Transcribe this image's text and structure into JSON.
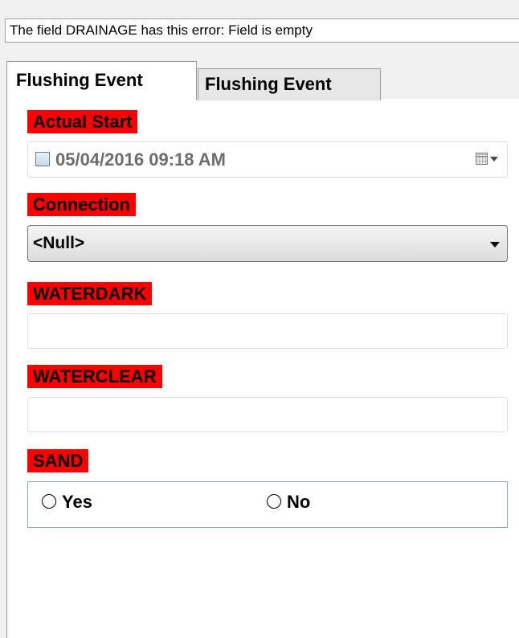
{
  "error_message": "The field DRAINAGE has this error: Field is empty",
  "tabs": [
    {
      "label": "Flushing Event",
      "active": true
    },
    {
      "label": "Flushing Event",
      "active": false
    }
  ],
  "form": {
    "actual_start": {
      "label": "Actual Start",
      "value": "05/04/2016 09:18 AM",
      "checked": false
    },
    "connection": {
      "label": "Connection",
      "selected": "<Null>"
    },
    "waterdark": {
      "label": "WATERDARK",
      "value": ""
    },
    "waterclear": {
      "label": "WATERCLEAR",
      "value": ""
    },
    "sand": {
      "label": "SAND",
      "options": [
        "Yes",
        "No"
      ],
      "selected": null
    }
  },
  "colors": {
    "required_label_bg": "#ff0000",
    "panel_bg": "#ffffff",
    "window_bg": "#f0f0f0"
  }
}
